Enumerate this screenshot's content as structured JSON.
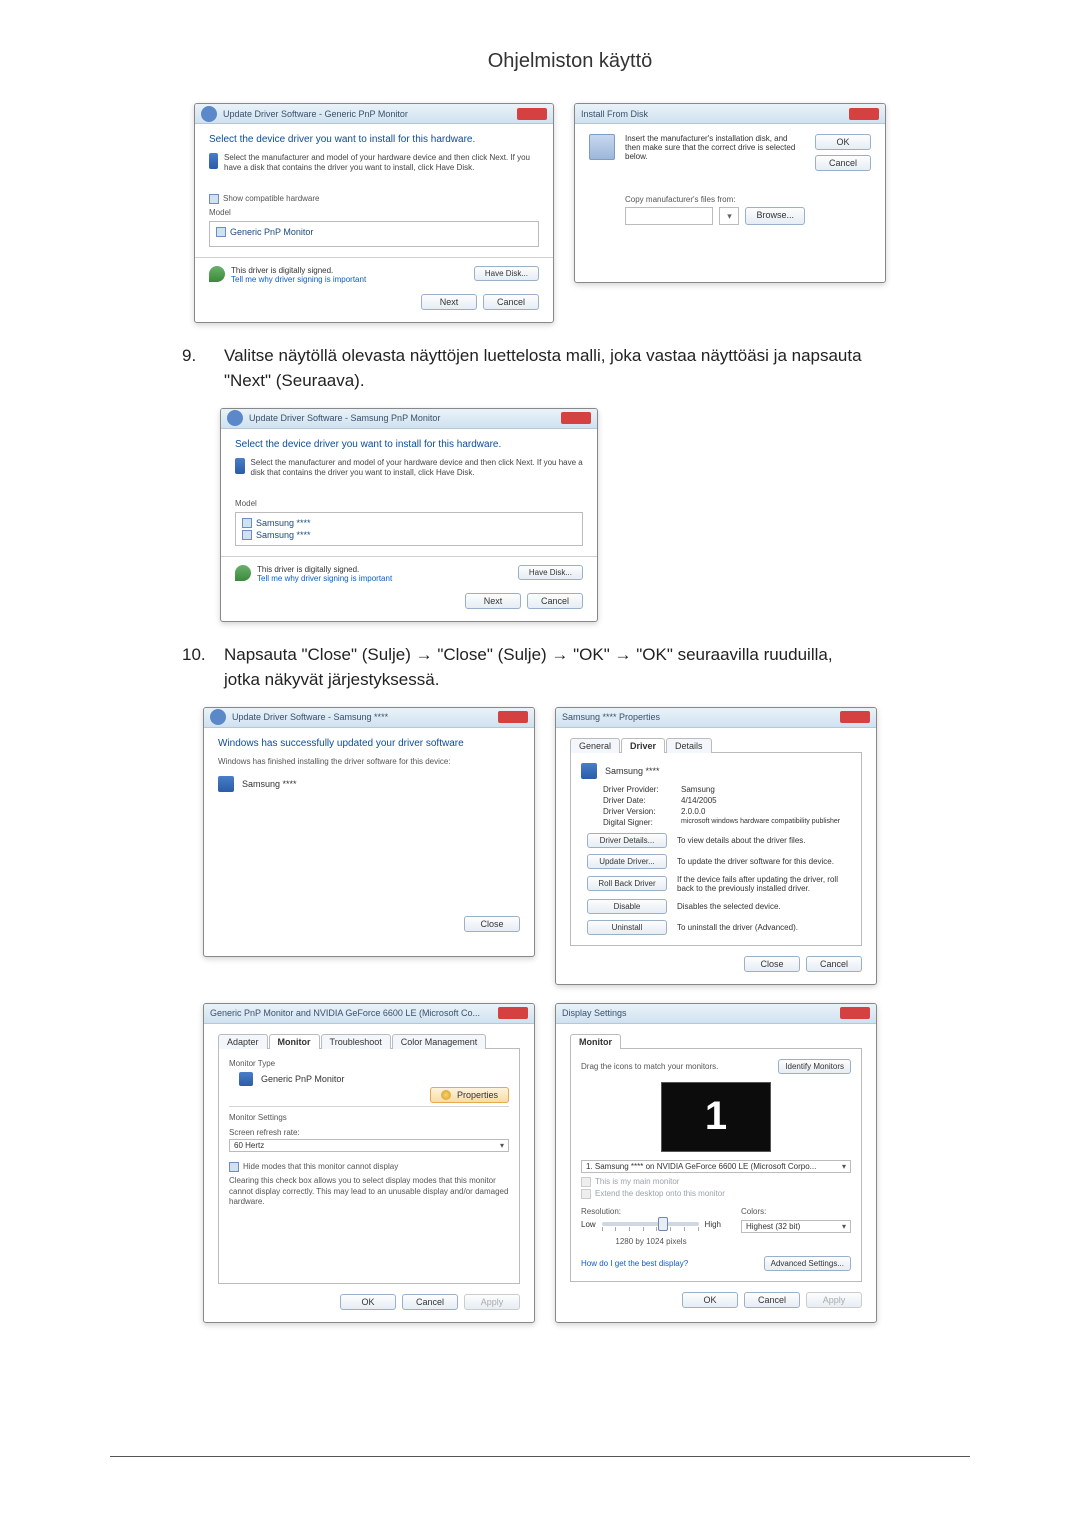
{
  "page": {
    "section_title": "Ohjelmiston käyttö"
  },
  "steps": {
    "s9_num": "9.",
    "s9_text": "Valitse näytöllä olevasta näyttöjen luettelosta malli, joka vastaa näyttöäsi ja napsauta \"Next\" (Seuraava).",
    "s10_num": "10.",
    "s10_text": "Napsauta \"Close\" (Sulje) → \"Close\" (Sulje) → \"OK\" → \"OK\" seuraavilla ruuduilla, jotka näkyvät järjestyksessä."
  },
  "dlg": {
    "update_a": {
      "title": "Update Driver Software - Generic PnP Monitor",
      "heading": "Select the device driver you want to install for this hardware.",
      "sub": "Select the manufacturer and model of your hardware device and then click Next. If you have a disk that contains the driver you want to install, click Have Disk.",
      "show_compat": "Show compatible hardware",
      "model_hdr": "Model",
      "item1": "Generic PnP Monitor",
      "signed": "This driver is digitally signed.",
      "tell": "Tell me why driver signing is important",
      "have_disk": "Have Disk...",
      "next": "Next",
      "cancel": "Cancel"
    },
    "install_disk": {
      "title": "Install From Disk",
      "msg": "Insert the manufacturer's installation disk, and then make sure that the correct drive is selected below.",
      "ok": "OK",
      "cancel": "Cancel",
      "copy_label": "Copy manufacturer's files from:",
      "browse": "Browse..."
    },
    "update_b": {
      "title": "Update Driver Software - Samsung PnP Monitor",
      "heading": "Select the device driver you want to install for this hardware.",
      "sub": "Select the manufacturer and model of your hardware device and then click Next. If you have a disk that contains the driver you want to install, click Have Disk.",
      "model_hdr": "Model",
      "item1": "Samsung ****",
      "item2": "Samsung ****",
      "signed": "This driver is digitally signed.",
      "tell": "Tell me why driver signing is important",
      "have_disk": "Have Disk...",
      "next": "Next",
      "cancel": "Cancel"
    },
    "update_done": {
      "title": "Update Driver Software - Samsung ****",
      "heading": "Windows has successfully updated your driver software",
      "sub": "Windows has finished installing the driver software for this device:",
      "device": "Samsung ****",
      "close": "Close"
    },
    "props": {
      "title": "Samsung **** Properties",
      "tab_general": "General",
      "tab_driver": "Driver",
      "tab_details": "Details",
      "device": "Samsung ****",
      "provider_k": "Driver Provider:",
      "provider_v": "Samsung",
      "date_k": "Driver Date:",
      "date_v": "4/14/2005",
      "version_k": "Driver Version:",
      "version_v": "2.0.0.0",
      "signer_k": "Digital Signer:",
      "signer_v": "microsoft windows hardware compatibility publisher",
      "details_btn": "Driver Details...",
      "details_desc": "To view details about the driver files.",
      "update_btn": "Update Driver...",
      "update_desc": "To update the driver software for this device.",
      "rollback_btn": "Roll Back Driver",
      "rollback_desc": "If the device fails after updating the driver, roll back to the previously installed driver.",
      "disable_btn": "Disable",
      "disable_desc": "Disables the selected device.",
      "uninstall_btn": "Uninstall",
      "uninstall_desc": "To uninstall the driver (Advanced).",
      "close": "Close",
      "cancel": "Cancel"
    },
    "mon_props": {
      "title": "Generic PnP Monitor and NVIDIA GeForce 6600 LE (Microsoft Co...",
      "tab_adapter": "Adapter",
      "tab_monitor": "Monitor",
      "tab_trouble": "Troubleshoot",
      "tab_color": "Color Management",
      "type_hdr": "Monitor Type",
      "type_val": "Generic PnP Monitor",
      "prop_btn": "Properties",
      "settings_hdr": "Monitor Settings",
      "refresh_lbl": "Screen refresh rate:",
      "refresh_val": "60 Hertz",
      "hide_chk": "Hide modes that this monitor cannot display",
      "hide_desc": "Clearing this check box allows you to select display modes that this monitor cannot display correctly. This may lead to an unusable display and/or damaged hardware.",
      "ok": "OK",
      "cancel": "Cancel",
      "apply": "Apply"
    },
    "display": {
      "title": "Display Settings",
      "tab_monitor": "Monitor",
      "drag": "Drag the icons to match your monitors.",
      "identify": "Identify Monitors",
      "mon_num": "1",
      "sel_mon": "1. Samsung **** on NVIDIA GeForce 6600 LE (Microsoft Corpo...",
      "chk_main": "This is my main monitor",
      "chk_extend": "Extend the desktop onto this monitor",
      "res_hdr": "Resolution:",
      "colors_hdr": "Colors:",
      "low": "Low",
      "high": "High",
      "res_val": "1280 by 1024 pixels",
      "color_val": "Highest (32 bit)",
      "howto": "How do I get the best display?",
      "adv": "Advanced Settings...",
      "ok": "OK",
      "cancel": "Cancel",
      "apply": "Apply"
    }
  }
}
